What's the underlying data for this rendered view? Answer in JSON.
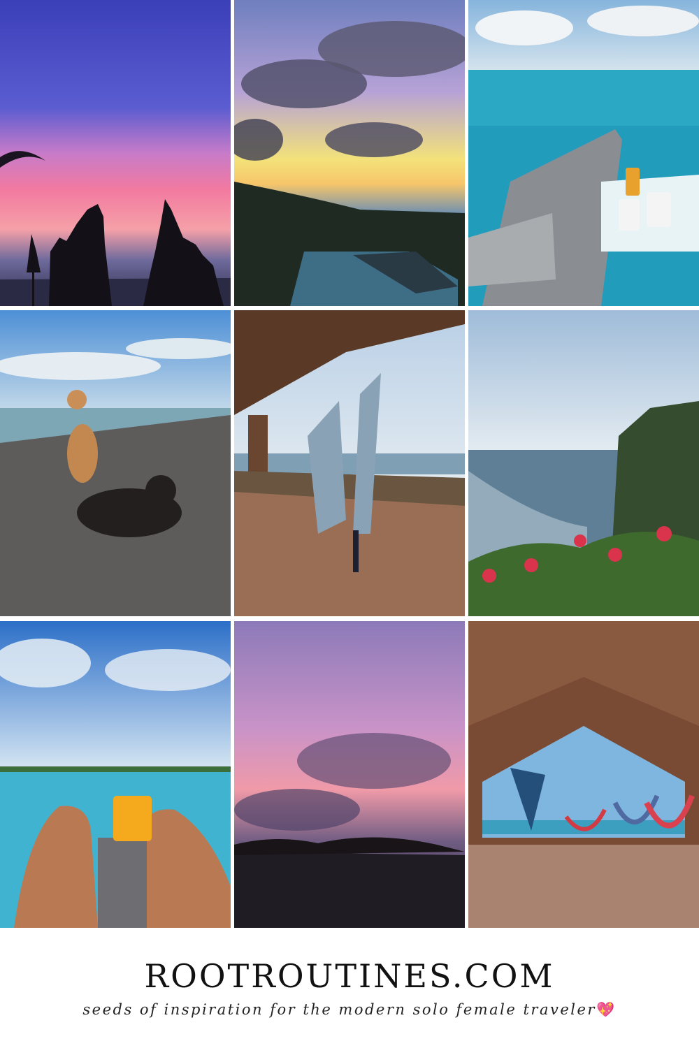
{
  "photos": [
    {
      "id": "sunset-temple",
      "alt": "sunset temple silhouette"
    },
    {
      "id": "cloudy-sunset-pool",
      "alt": "cloudy sunset over infinity pool"
    },
    {
      "id": "poolside-loungers",
      "alt": "loungers with towel and coffee by pool"
    },
    {
      "id": "beach-dogs",
      "alt": "two dogs on black sand beach"
    },
    {
      "id": "aerial-yoga",
      "alt": "aerial yoga hammock on wooden deck"
    },
    {
      "id": "cliff-ocean",
      "alt": "cliff over ocean with bougainvillea"
    },
    {
      "id": "pool-drink",
      "alt": "legs and drink at infinity pool"
    },
    {
      "id": "pink-sunset",
      "alt": "pink sunset over palm trees"
    },
    {
      "id": "yoga-pavilion",
      "alt": "yoga pavilion with hammocks"
    }
  ],
  "footer": {
    "title": "ROOTROUTINES.COM",
    "tagline": "seeds of inspiration for the modern solo female traveler",
    "tagline_emoji": "💖"
  },
  "colors": {
    "background": "#ffffff",
    "title": "#111111"
  }
}
